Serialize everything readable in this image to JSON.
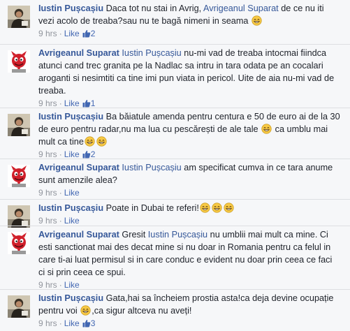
{
  "comments": [
    {
      "author": "Iustin Pușcașiu",
      "avatar": "iustin-avatar",
      "t1": "Daca tot nu stai in Avrig, ",
      "mention": "Avrigeanul Suparat",
      "t2": " de ce nu iti vezi acolo de treaba?sau nu te bagă nimeni in seama ",
      "time": "9 hrs",
      "like": "Like",
      "likes": "2"
    },
    {
      "author": "Avrigeanul Suparat",
      "avatar": "devil-avatar",
      "mention": "Iustin Pușcașiu",
      "t1": " nu-mi vad de treaba intocmai fiindca atunci cand trec granita pe la Nadlac sa intru in tara odata pe an cocalari aroganti si nesimtiti ca tine imi pun viata in pericol. Uite de aia nu-mi vad de treaba.",
      "time": "9 hrs",
      "like": "Like",
      "likes": "1"
    },
    {
      "author": "Iustin Pușcașiu",
      "avatar": "iustin-avatar",
      "t1": "Ba băiatule amenda pentru centura e 50 de euro ai de la 30 de euro pentru radar,nu ma lua cu pescărești de ale tale ",
      "t2": " ca umblu mai mult ca tine",
      "time": "9 hrs",
      "like": "Like",
      "likes": "2"
    },
    {
      "author": "Avrigeanul Suparat",
      "avatar": "devil-avatar",
      "mention": "Iustin Pușcașiu",
      "t1": " am specificat cumva in ce tara anume sunt amenzile alea?",
      "time": "9 hrs",
      "like": "Like"
    },
    {
      "author": "Iustin Pușcașiu",
      "avatar": "iustin-avatar",
      "t1": "Poate in Dubai te referi!",
      "time": "9 hrs",
      "like": "Like"
    },
    {
      "author": "Avrigeanul Suparat",
      "avatar": "devil-avatar",
      "t1": "Gresit ",
      "mention": "Iustin Pușcașiu",
      "t2": " nu umblii mai mult ca mine. Ci esti sanctionat mai des decat mine si nu doar in Romania pentru ca felul in care ti-ai luat permisul si in care conduc e evident nu doar prin ceea ce faci ci si prin ceea ce spui.",
      "time": "9 hrs",
      "like": "Like"
    },
    {
      "author": "Iustin Pușcașiu",
      "avatar": "iustin-avatar",
      "t1": "Gata,hai sa încheiem prostia asta!ca deja devine ocupație pentru voi ",
      "t2": ",ca sigur altceva nu aveți!",
      "time": "9 hrs",
      "like": "Like",
      "likes": "3"
    }
  ],
  "icons": {
    "emoji": "grinning-emoji",
    "like": "thumbs-up-icon"
  },
  "colors": {
    "link": "#365899",
    "meta": "#90949c",
    "like_blue": "#4267b2",
    "emoji_yellow": "#f7c945"
  }
}
